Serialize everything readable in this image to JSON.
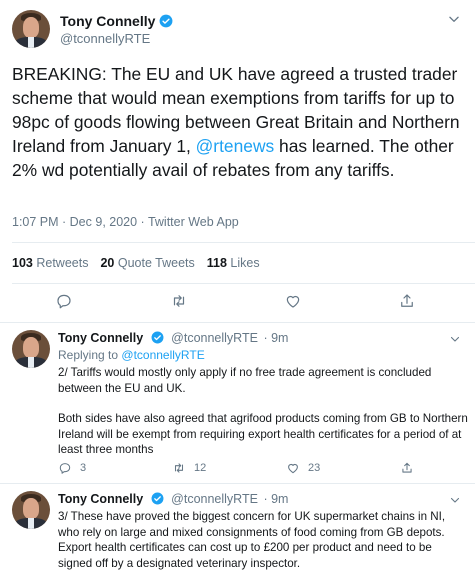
{
  "main_tweet": {
    "author_name": "Tony Connelly",
    "author_handle": "@tconnellyRTE",
    "text_before": "BREAKING: The EU and UK have agreed a trusted trader scheme that would mean exemptions from tariffs for up to 98pc of goods flowing between Great Britain and Northern Ireland from January 1, ",
    "mention": "@rtenews",
    "text_after": " has learned. The other 2% wd potentially avail of rebates from any tariffs.",
    "timestamp": "1:07 PM · Dec 9, 2020 · Twitter Web App",
    "retweets_count": "103",
    "retweets_label": "Retweets",
    "quotes_count": "20",
    "quotes_label": "Quote Tweets",
    "likes_count": "118",
    "likes_label": "Likes"
  },
  "replies": [
    {
      "author_name": "Tony Connelly",
      "author_handle": "@tconnellyRTE",
      "time_ago": "· 9m",
      "replying_to_label": "Replying to",
      "replying_to_handle": "@tconnellyRTE",
      "paragraph1": "2/ Tariffs would mostly only apply if no free trade agreement is concluded between the EU and UK.",
      "paragraph2": "Both sides have also agreed that agrifood products coming from GB to Northern Ireland will be exempt from requiring export health certificates for a period of at least three months",
      "reply_count": "3",
      "retweet_count": "12",
      "like_count": "23"
    },
    {
      "author_name": "Tony Connelly",
      "author_handle": "@tconnellyRTE",
      "time_ago": "· 9m",
      "paragraph1": "3/ These have proved the biggest concern for UK supermarket chains in NI, who rely on large and mixed consignments of food coming from GB depots. Export health certificates can cost up to £200 per product and need to be signed off by a designated veterinary inspector."
    }
  ],
  "colors": {
    "accent": "#1da1f2",
    "text": "#14171a",
    "muted": "#657786",
    "divider": "#e6ecf0"
  },
  "icons": [
    "verified-badge-icon",
    "chevron-down-icon",
    "reply-icon",
    "retweet-icon",
    "like-icon",
    "share-icon"
  ]
}
